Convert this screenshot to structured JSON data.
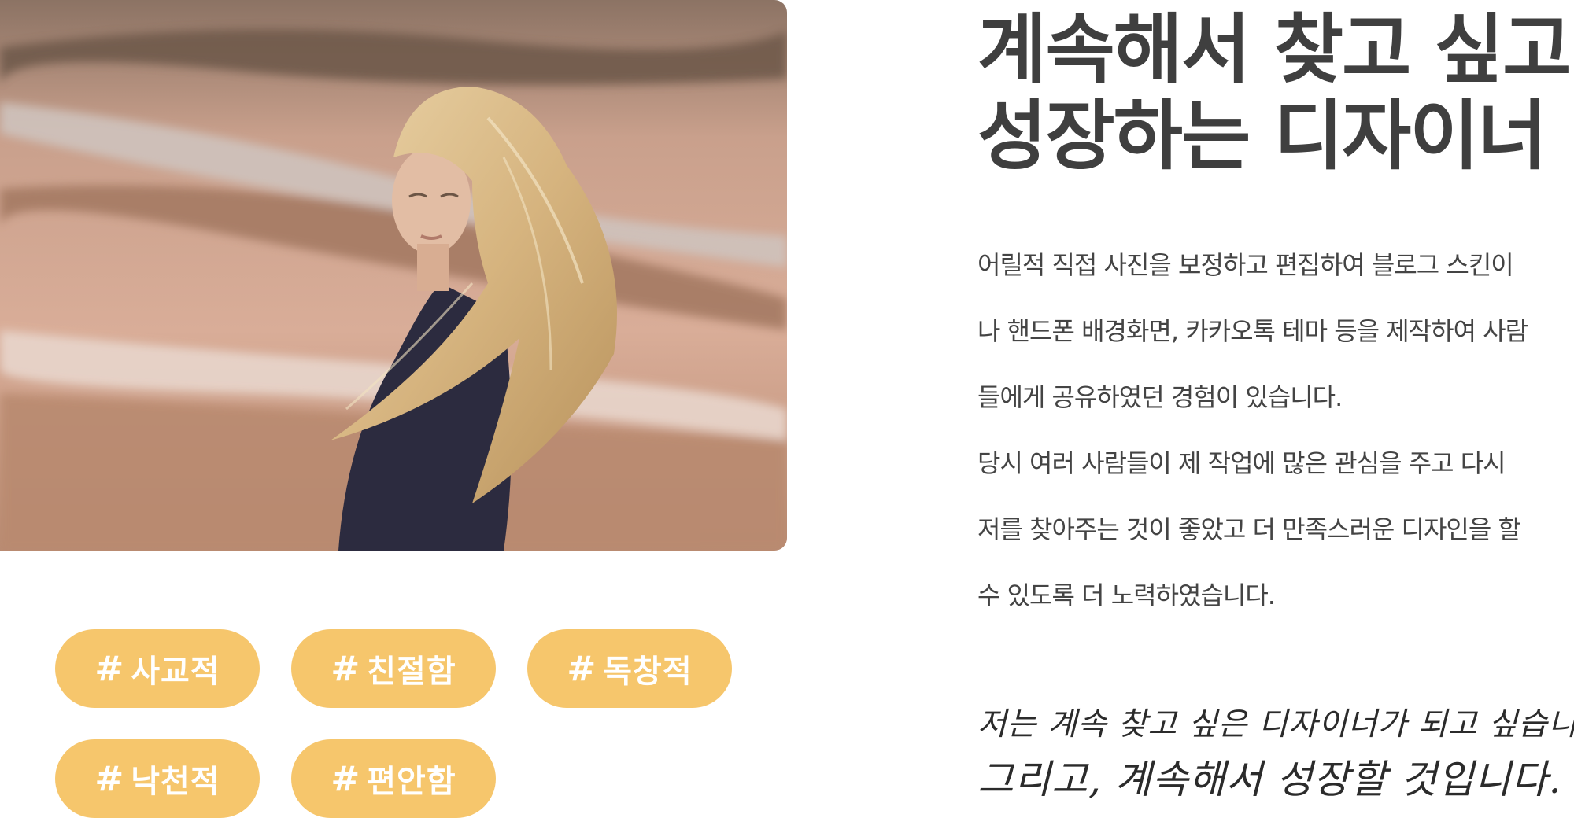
{
  "photo": {
    "description_icon": "woman-wind-hair-image"
  },
  "tags": [
    {
      "label": "사교적"
    },
    {
      "label": "친절함"
    },
    {
      "label": "독창적"
    },
    {
      "label": "낙천적"
    },
    {
      "label": "편안함"
    }
  ],
  "tag_prefix": "#",
  "headline": {
    "line1": "계속해서 찾고 싶고",
    "line2": "성장하는 디자이너"
  },
  "body": [
    " 어릴적 직접 사진을 보정하고 편집하여 블로그 스킨이",
    "나 핸드폰 배경화면, 카카오톡 테마 등을 제작하여 사람",
    "들에게 공유하였던 경험이 있습니다.",
    " 당시 여러 사람들이 제 작업에 많은 관심을 주고 다시",
    "저를 찾아주는 것이 좋았고 더 만족스러운 디자인을 할",
    "수 있도록 더 노력하였습니다."
  ],
  "handwriting": {
    "line1": "저는 계속 찾고 싶은 디자이너가 되고 싶습니다.",
    "line2": "그리고, 계속해서 성장할 것입니다."
  },
  "colors": {
    "tag_bg": "#f6c66c",
    "headline": "#3f3f3f",
    "body": "#444444"
  }
}
